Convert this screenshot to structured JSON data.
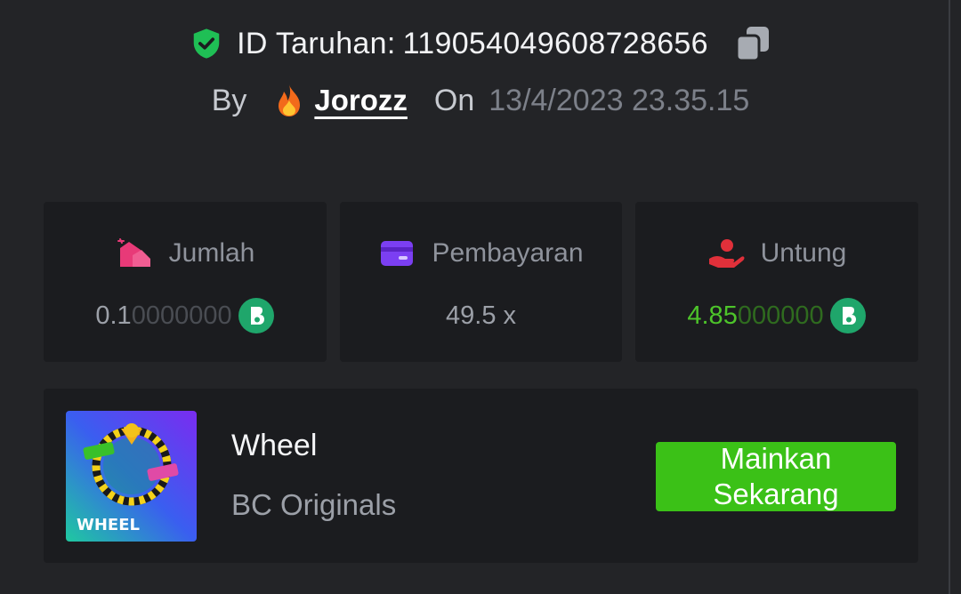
{
  "header": {
    "bet_id_label": "ID Taruhan:",
    "bet_id": "119054049608728656",
    "by_label": "By",
    "username": "Jorozz",
    "on_label": "On",
    "datetime": "13/4/2023 23.35.15"
  },
  "stats": {
    "amount": {
      "label": "Jumlah",
      "value_main": "0.1",
      "value_dim": "0000000",
      "coin": "bc-coin-icon"
    },
    "payout": {
      "label": "Pembayaran",
      "value": "49.5 x"
    },
    "profit": {
      "label": "Untung",
      "value_main": "4.85",
      "value_dim": "000000",
      "coin": "bc-coin-icon"
    }
  },
  "game": {
    "name": "Wheel",
    "provider": "BC Originals",
    "play_label": "Mainkan Sekarang",
    "thumbnail_text": "WHEEL",
    "thumbnail_labels": [
      "39.6x",
      "49.50x",
      "19.8x"
    ]
  },
  "colors": {
    "background": "#232427",
    "card": "#1b1c1f",
    "accent_green": "#3bc117",
    "profit_green": "#4dc42a",
    "shield_green": "#1fbf55",
    "amount_pink": "#e83a78",
    "payout_purple": "#7b3ff2",
    "profit_red": "#e0303a"
  }
}
